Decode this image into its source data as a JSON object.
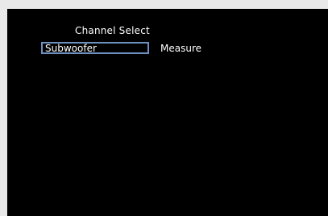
{
  "menu": {
    "title": "Channel Select",
    "channel_value": "Subwoofer",
    "measure_label": "Measure"
  },
  "colors": {
    "background": "#e9e9e9",
    "screen": "#000000",
    "text": "#ffffff",
    "selection_border": "#6e8fc0"
  }
}
